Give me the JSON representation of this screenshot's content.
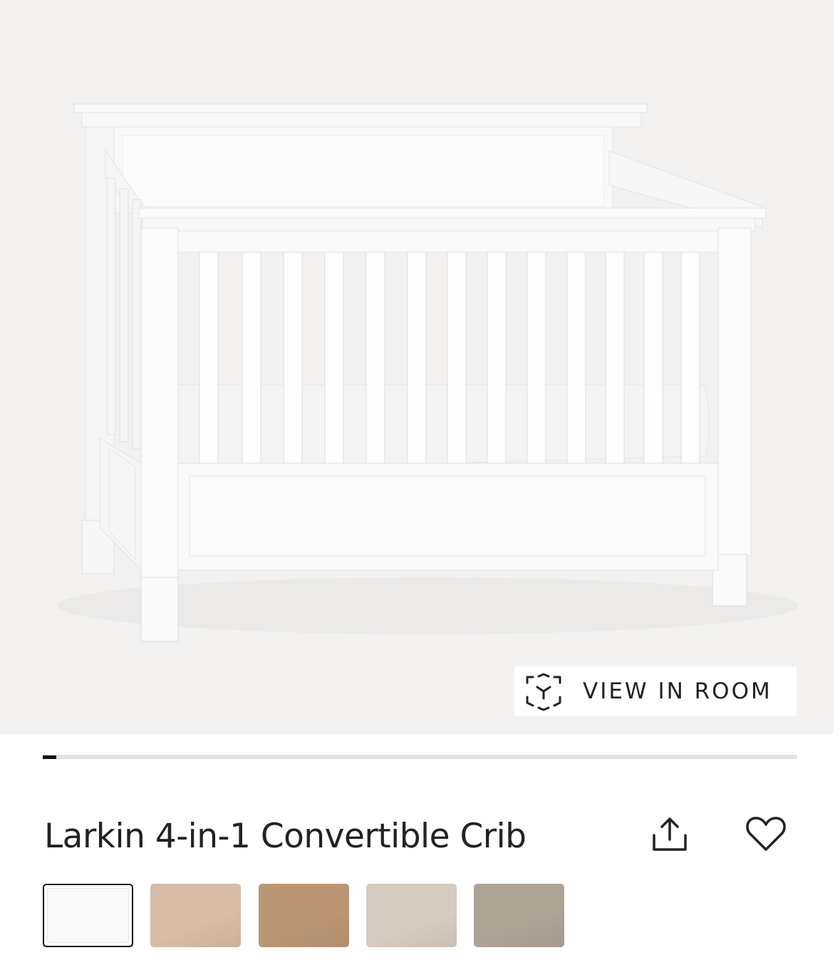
{
  "product": {
    "title": "Larkin 4-in-1 Convertible Crib"
  },
  "hero": {
    "view_in_room_label": "VIEW IN ROOM",
    "ar_icon": "ar-cube-icon",
    "background": "#f3f2f1"
  },
  "gallery": {
    "progress": 0.018
  },
  "actions": {
    "share_icon": "share-icon",
    "favorite_icon": "heart-icon"
  },
  "finish_swatches": [
    {
      "color": "#fafafa",
      "selected": true
    },
    {
      "color": "#d8bca5",
      "selected": false
    },
    {
      "color": "#bb9674",
      "selected": false
    },
    {
      "color": "#d6cbc0",
      "selected": false
    },
    {
      "color": "#aea496",
      "selected": false
    }
  ]
}
